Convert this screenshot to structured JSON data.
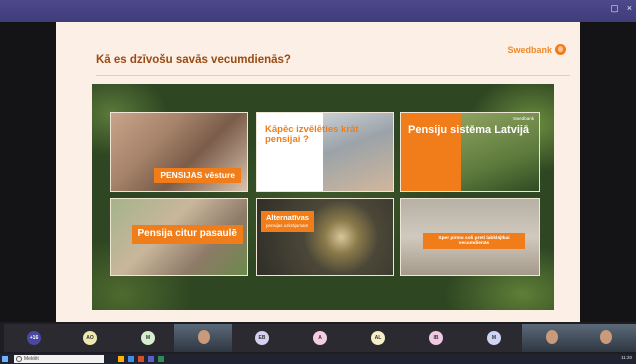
{
  "window": {
    "controls": [
      "▢",
      "×"
    ]
  },
  "slide": {
    "title": "Kā es dzīvošu savās vecumdienās?",
    "logo": "Swedbank",
    "cards": [
      {
        "label": "PENSIJAS vēsture"
      },
      {
        "label": "Kāpēc izvēlēties krāt pensijai ?"
      },
      {
        "label": "Pensiju sistēma Latvijā",
        "mini_logo": "Swedbank"
      },
      {
        "label": "Pensija citur pasaulē"
      },
      {
        "label": "Alternatīvas",
        "sub": "pensijas uzkrājumam"
      },
      {
        "label": "Spersoli preti labklājībai vecumdienās",
        "sub": "Sper pirmo soli preti labklājībai vecumdienās"
      }
    ]
  },
  "participants": [
    {
      "initials": "+16",
      "type": "more"
    },
    {
      "initials": "AO",
      "color": "#efe8b0"
    },
    {
      "initials": "M",
      "color": "#d7efcf"
    },
    {
      "initials": "",
      "type": "camera"
    },
    {
      "initials": "EB",
      "color": "#d8d0f0"
    },
    {
      "initials": "A",
      "color": "#f5cde0"
    },
    {
      "initials": "AL",
      "color": "#f6efc7"
    },
    {
      "initials": "IB",
      "color": "#f1c9e3"
    },
    {
      "initials": "M",
      "color": "#cfd4f5"
    },
    {
      "initials": "",
      "type": "camera"
    },
    {
      "initials": "",
      "type": "camera"
    }
  ],
  "taskbar": {
    "search_placeholder": "Meklēt",
    "time": "11:20"
  },
  "colors": {
    "accent": "#f07d1a",
    "title": "#9a4a12",
    "teams_purple": "#4a47a0"
  }
}
